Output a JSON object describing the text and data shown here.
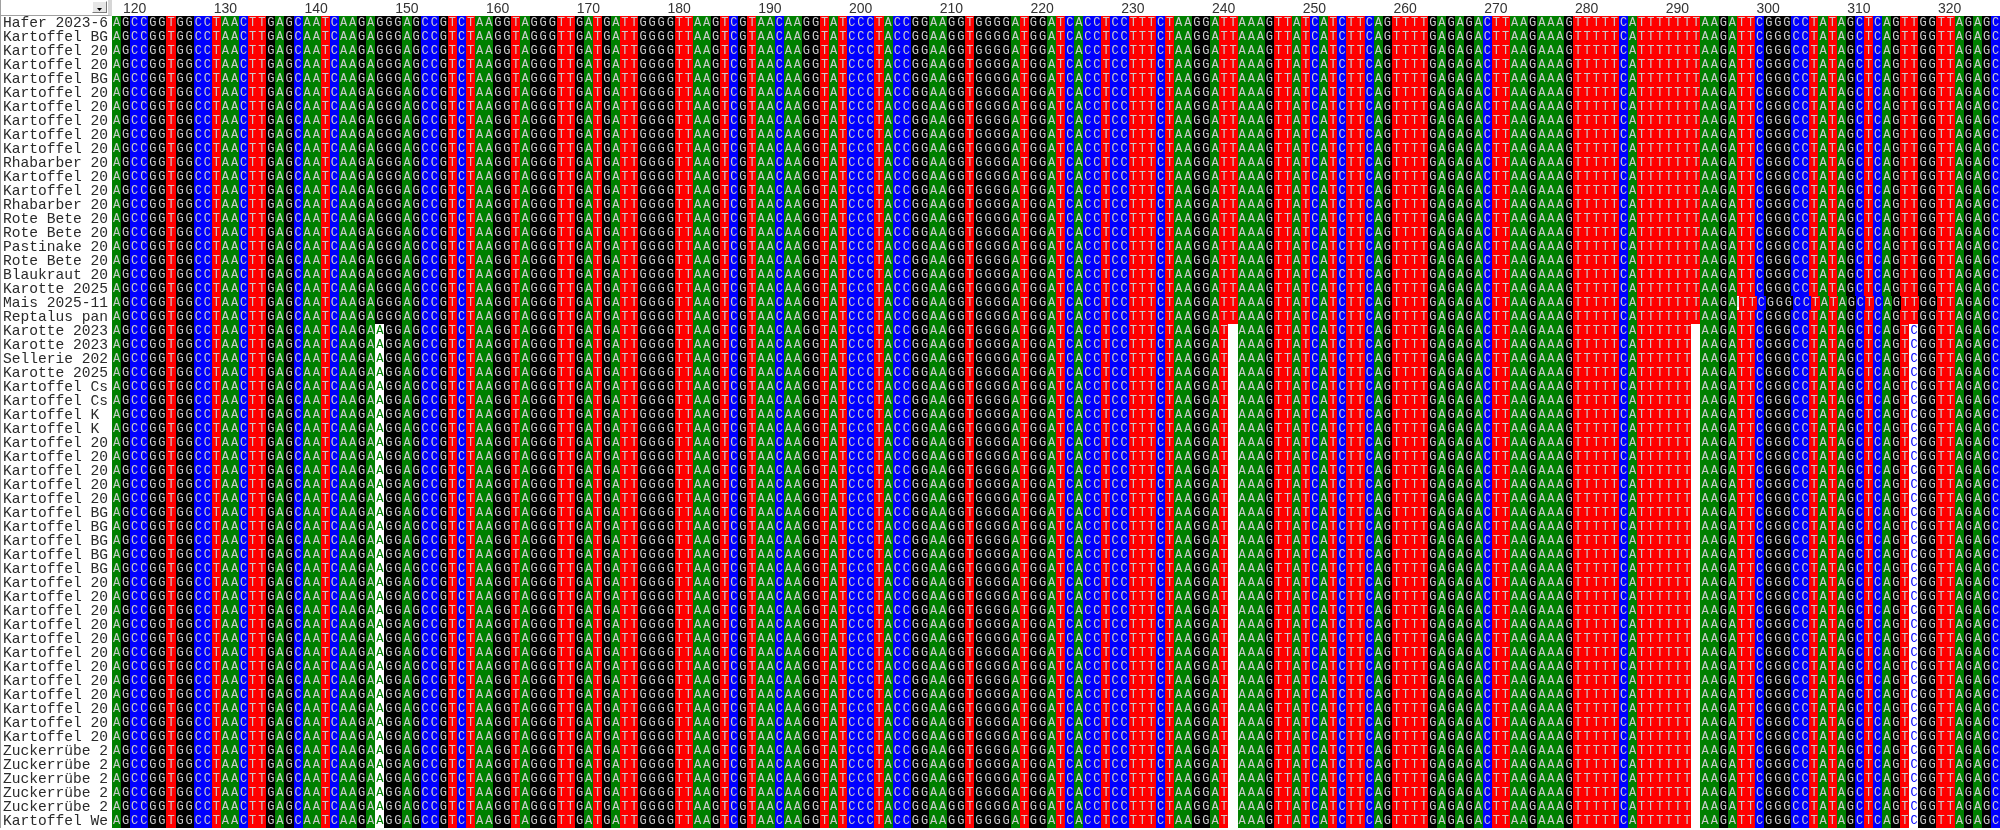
{
  "ruler": {
    "labels": [
      "120",
      "130",
      "140",
      "150",
      "160",
      "170",
      "180",
      "190",
      "200",
      "210",
      "220",
      "230",
      "240",
      "250",
      "260",
      "270",
      "280",
      "290",
      "300",
      "310",
      "320"
    ]
  },
  "sequences": [
    {
      "name": "Hafer 2023-6",
      "segments": [
        {
          "kind": "bases",
          "text": "AGCCGGTGGCCTAACTTGAGCAATCAAGAGGGAGCCGTCTAAGGTAGGGTTGATGATTGGGGTTAAGTCGTAACAAGGTATCCCTACCGGAAGGTGGGGATGGATCACCTCCTTTCTAAGGATTAAAGTTATCATCTTCAGTTTTGAGAGACTTAAGAAAGTTTTTCATTTTTTTAAGATTCGGGCCTATAGCTCAGTTGGTTAGAGC"
        }
      ]
    },
    {
      "name": "Kartoffel BG",
      "segments": [
        {
          "kind": "bases",
          "text": "AGCCGGTGGCCTAACTTGAGCAATCAAGAGGGAGCCGTCTAAGGTAGGGTTGATGATTGGGGTTAAGTCGTAACAAGGTATCCCTACCGGAAGGTGGGGATGGATCACCTCCTTTCTAAGGATTAAAGTTATCATCTTCAGTTTTGAGAGACTTAAGAAAGTTTTTCATTTTTTTAAGATTCGGGCCTATAGCTCAGTTGGTTAGAGC"
        }
      ]
    },
    {
      "name": "Kartoffel 20",
      "segments": [
        {
          "kind": "bases",
          "text": "AGCCGGTGGCCTAACTTGAGCAATCAAGAGGGAGCCGTCTAAGGTAGGGTTGATGATTGGGGTTAAGTCGTAACAAGGTATCCCTACCGGAAGGTGGGGATGGATCACCTCCTTTCTAAGGATTAAAGTTATCATCTTCAGTTTTGAGAGACTTAAGAAAGTTTTTCATTTTTTTAAGATTCGGGCCTATAGCTCAGTTGGTTAGAGC"
        }
      ]
    },
    {
      "name": "Kartoffel 20",
      "segments": [
        {
          "kind": "bases",
          "text": "AGCCGGTGGCCTAACTTGAGCAATCAAGAGGGAGCCGTCTAAGGTAGGGTTGATGATTGGGGTTAAGTCGTAACAAGGTATCCCTACCGGAAGGTGGGGATGGATCACCTCCTTTCTAAGGATTAAAGTTATCATCTTCAGTTTTGAGAGACTTAAGAAAGTTTTTCATTTTTTTAAGATTCGGGCCTATAGCTCAGTTGGTTAGAGC"
        }
      ]
    },
    {
      "name": "Kartoffel BG",
      "segments": [
        {
          "kind": "bases",
          "text": "AGCCGGTGGCCTAACTTGAGCAATCAAGAGGGAGCCGTCTAAGGTAGGGTTGATGATTGGGGTTAAGTCGTAACAAGGTATCCCTACCGGAAGGTGGGGATGGATCACCTCCTTTCTAAGGATTAAAGTTATCATCTTCAGTTTTGAGAGACTTAAGAAAGTTTTTCATTTTTTTAAGATTCGGGCCTATAGCTCAGTTGGTTAGAGC"
        }
      ]
    },
    {
      "name": "Kartoffel 20",
      "segments": [
        {
          "kind": "bases",
          "text": "AGCCGGTGGCCTAACTTGAGCAATCAAGAGGGAGCCGTCTAAGGTAGGGTTGATGATTGGGGTTAAGTCGTAACAAGGTATCCCTACCGGAAGGTGGGGATGGATCACCTCCTTTCTAAGGATTAAAGTTATCATCTTCAGTTTTGAGAGACTTAAGAAAGTTTTTCATTTTTTTAAGATTCGGGCCTATAGCTCAGTTGGTTAGAGC"
        }
      ]
    },
    {
      "name": "Kartoffel 20",
      "segments": [
        {
          "kind": "bases",
          "text": "AGCCGGTGGCCTAACTTGAGCAATCAAGAGGGAGCCGTCTAAGGTAGGGTTGATGATTGGGGTTAAGTCGTAACAAGGTATCCCTACCGGAAGGTGGGGATGGATCACCTCCTTTCTAAGGATTAAAGTTATCATCTTCAGTTTTGAGAGACTTAAGAAAGTTTTTCATTTTTTTAAGATTCGGGCCTATAGCTCAGTTGGTTAGAGC"
        }
      ]
    },
    {
      "name": "Kartoffel 20",
      "segments": [
        {
          "kind": "bases",
          "text": "AGCCGGTGGCCTAACTTGAGCAATCAAGAGGGAGCCGTCTAAGGTAGGGTTGATGATTGGGGTTAAGTCGTAACAAGGTATCCCTACCGGAAGGTGGGGATGGATCACCTCCTTTCTAAGGATTAAAGTTATCATCTTCAGTTTTGAGAGACTTAAGAAAGTTTTTCATTTTTTTAAGATTCGGGCCTATAGCTCAGTTGGTTAGAGC"
        }
      ]
    },
    {
      "name": "Kartoffel 20",
      "segments": [
        {
          "kind": "bases",
          "text": "AGCCGGTGGCCTAACTTGAGCAATCAAGAGGGAGCCGTCTAAGGTAGGGTTGATGATTGGGGTTAAGTCGTAACAAGGTATCCCTACCGGAAGGTGGGGATGGATCACCTCCTTTCTAAGGATTAAAGTTATCATCTTCAGTTTTGAGAGACTTAAGAAAGTTTTTCATTTTTTTAAGATTCGGGCCTATAGCTCAGTTGGTTAGAGC"
        }
      ]
    },
    {
      "name": "Kartoffel 20",
      "segments": [
        {
          "kind": "bases",
          "text": "AGCCGGTGGCCTAACTTGAGCAATCAAGAGGGAGCCGTCTAAGGTAGGGTTGATGATTGGGGTTAAGTCGTAACAAGGTATCCCTACCGGAAGGTGGGGATGGATCACCTCCTTTCTAAGGATTAAAGTTATCATCTTCAGTTTTGAGAGACTTAAGAAAGTTTTTCATTTTTTTAAGATTCGGGCCTATAGCTCAGTTGGTTAGAGC"
        }
      ]
    },
    {
      "name": "Rhabarber 20",
      "segments": [
        {
          "kind": "bases",
          "text": "AGCCGGTGGCCTAACTTGAGCAATCAAGAGGGAGCCGTCTAAGGTAGGGTTGATGATTGGGGTTAAGTCGTAACAAGGTATCCCTACCGGAAGGTGGGGATGGATCACCTCCTTTCTAAGGATTAAAGTTATCATCTTCAGTTTTGAGAGACTTAAGAAAGTTTTTCATTTTTTTAAGATTCGGGCCTATAGCTCAGTTGGTTAGAGC"
        }
      ]
    },
    {
      "name": "Kartoffel 20",
      "segments": [
        {
          "kind": "bases",
          "text": "AGCCGGTGGCCTAACTTGAGCAATCAAGAGGGAGCCGTCTAAGGTAGGGTTGATGATTGGGGTTAAGTCGTAACAAGGTATCCCTACCGGAAGGTGGGGATGGATCACCTCCTTTCTAAGGATTAAAGTTATCATCTTCAGTTTTGAGAGACTTAAGAAAGTTTTTCATTTTTTTAAGATTCGGGCCTATAGCTCAGTTGGTTAGAGC"
        }
      ]
    },
    {
      "name": "Kartoffel 20",
      "segments": [
        {
          "kind": "bases",
          "text": "AGCCGGTGGCCTAACTTGAGCAATCAAGAGGGAGCCGTCTAAGGTAGGGTTGATGATTGGGGTTAAGTCGTAACAAGGTATCCCTACCGGAAGGTGGGGATGGATCACCTCCTTTCTAAGGATTAAAGTTATCATCTTCAGTTTTGAGAGACTTAAGAAAGTTTTTCATTTTTTTAAGATTCGGGCCTATAGCTCAGTTGGTTAGAGC"
        }
      ]
    },
    {
      "name": "Rhabarber 20",
      "segments": [
        {
          "kind": "bases",
          "text": "AGCCGGTGGCCTAACTTGAGCAATCAAGAGGGAGCCGTCTAAGGTAGGGTTGATGATTGGGGTTAAGTCGTAACAAGGTATCCCTACCGGAAGGTGGGGATGGATCACCTCCTTTCTAAGGATTAAAGTTATCATCTTCAGTTTTGAGAGACTTAAGAAAGTTTTTCATTTTTTTAAGATTCGGGCCTATAGCTCAGTTGGTTAGAGC"
        }
      ]
    },
    {
      "name": "Rote Bete 20",
      "segments": [
        {
          "kind": "bases",
          "text": "AGCCGGTGGCCTAACTTGAGCAATCAAGAGGGAGCCGTCTAAGGTAGGGTTGATGATTGGGGTTAAGTCGTAACAAGGTATCCCTACCGGAAGGTGGGGATGGATCACCTCCTTTCTAAGGATTAAAGTTATCATCTTCAGTTTTGAGAGACTTAAGAAAGTTTTTCATTTTTTTAAGATTCGGGCCTATAGCTCAGTTGGTTAGAGC"
        }
      ]
    },
    {
      "name": "Rote Bete 20",
      "segments": [
        {
          "kind": "bases",
          "text": "AGCCGGTGGCCTAACTTGAGCAATCAAGAGGGAGCCGTCTAAGGTAGGGTTGATGATTGGGGTTAAGTCGTAACAAGGTATCCCTACCGGAAGGTGGGGATGGATCACCTCCTTTCTAAGGATTAAAGTTATCATCTTCAGTTTTGAGAGACTTAAGAAAGTTTTTCATTTTTTTAAGATTCGGGCCTATAGCTCAGTTGGTTAGAGC"
        }
      ]
    },
    {
      "name": "Pastinake 20",
      "segments": [
        {
          "kind": "bases",
          "text": "AGCCGGTGGCCTAACTTGAGCAATCAAGAGGGAGCCGTCTAAGGTAGGGTTGATGATTGGGGTTAAGTCGTAACAAGGTATCCCTACCGGAAGGTGGGGATGGATCACCTCCTTTCTAAGGATTAAAGTTATCATCTTCAGTTTTGAGAGACTTAAGAAAGTTTTTCATTTTTTTAAGATTCGGGCCTATAGCTCAGTTGGTTAGAGC"
        }
      ]
    },
    {
      "name": "Rote Bete 20",
      "segments": [
        {
          "kind": "bases",
          "text": "AGCCGGTGGCCTAACTTGAGCAATCAAGAGGGAGCCGTCTAAGGTAGGGTTGATGATTGGGGTTAAGTCGTAACAAGGTATCCCTACCGGAAGGTGGGGATGGATCACCTCCTTTCTAAGGATTAAAGTTATCATCTTCAGTTTTGAGAGACTTAAGAAAGTTTTTCATTTTTTTAAGATTCGGGCCTATAGCTCAGTTGGTTAGAGC"
        }
      ]
    },
    {
      "name": "Blaukraut 20",
      "segments": [
        {
          "kind": "bases",
          "text": "AGCCGGTGGCCTAACTTGAGCAATCAAGAGGGAGCCGTCTAAGGTAGGGTTGATGATTGGGGTTAAGTCGTAACAAGGTATCCCTACCGGAAGGTGGGGATGGATCACCTCCTTTCTAAGGATTAAAGTTATCATCTTCAGTTTTGAGAGACTTAAGAAAGTTTTTCATTTTTTTAAGATTCGGGCCTATAGCTCAGTTGGTTAGAGC"
        }
      ]
    },
    {
      "name": "Karotte 2025",
      "segments": [
        {
          "kind": "bases",
          "text": "AGCCGGTGGCCTAACTTGAGCAATCAAGAGGGAGCCGTCTAAGGTAGGGTTGATGATTGGGGTTAAGTCGTAACAAGGTATCCCTACCGGAAGGTGGGGATGGATCACCTCCTTTCTAAGGATTAAAGTTATCATCTTCAGTTTTGAGAGACTTAAGAAAGTTTTTCATTTTTTTAAGATTCGGGCCTATAGCTCAGTTGGTTAGAGC"
        }
      ]
    },
    {
      "name": "Mais 2025-11",
      "segments": [
        {
          "kind": "bases",
          "text": "AGCCGGTGGCCTAACTTGAGCAATCAAGAGGGAGCCGTCTAAGGTAGGGTTGATGATTGGGGTTAAGTCGTAACAAGGTATCCCTACCGGAAGGTGGGGATGGATCACCTCCTTTCTAAGGATTAAAGTTATCATCTTCAGTTTTGAGAGACTTAAGAAAGTTTTTCATTTTTTTAAGA"
        },
        {
          "kind": "cursor"
        },
        {
          "kind": "bases",
          "text": "TTCGGGCCTATAGCTCAGTTGGTTAGAGC"
        }
      ]
    },
    {
      "name": "Reptalus pan",
      "segments": [
        {
          "kind": "bases",
          "text": "AGCCGGTGGCCTAACTTGAGCAATCAAGAGGGAGCCGTCTAAGGTAGGGTTGATGATTGGGGTTAAGTCGTAACAAGGTATCCCTACCGGAAGGTGGGGATGGATCACCTCCTTTCTAAGGATTAAAGTTATCATCTTCAGTTTTGAGAGACTTAAGAAAGTTTTTCATTTTTTTAAGATTCGGGCCTATAGCTCAGTTGGTTAGAGC"
        }
      ]
    },
    {
      "name": "Karotte 2023",
      "segments": [
        {
          "kind": "bases",
          "text": "AGCCGGTGGCCTAACTTGAGCAATCAAGA"
        },
        {
          "kind": "marked",
          "text": "A"
        },
        {
          "kind": "bases",
          "text": "GGAGCCGTCTAAGGTAGGGTTGATGATTGGGGTTAAGTCGTAACAAGGTATCCCTACCGGAAGGTGGGGATGGATCACCTCCTTTCTAAGGAT"
        },
        {
          "kind": "gap"
        },
        {
          "kind": "bases",
          "text": "AAAGTTATCATCTTCAGTTTTGAGAGACTTAAGAAAGTTTTTCATTTTTT"
        },
        {
          "kind": "gap"
        },
        {
          "kind": "bases",
          "text": "AAGATTCGGGCCTATAGCTCAGT"
        },
        {
          "kind": "marked",
          "text": "C"
        },
        {
          "kind": "bases",
          "text": "GGTTAGAGC"
        }
      ]
    },
    {
      "name": "Karotte 2023",
      "segments": [
        {
          "kind": "bases",
          "text": "AGCCGGTGGCCTAACTTGAGCAATCAAGA"
        },
        {
          "kind": "marked",
          "text": "A"
        },
        {
          "kind": "bases",
          "text": "GGAGCCGTCTAAGGTAGGGTTGATGATTGGGGTTAAGTCGTAACAAGGTATCCCTACCGGAAGGTGGGGATGGATCACCTCCTTTCTAAGGAT"
        },
        {
          "kind": "gap"
        },
        {
          "kind": "bases",
          "text": "AAAGTTATCATCTTCAGTTTTGAGAGACTTAAGAAAGTTTTTCATTTTTT"
        },
        {
          "kind": "gap"
        },
        {
          "kind": "bases",
          "text": "AAGATTCGGGCCTATAGCTCAGT"
        },
        {
          "kind": "marked",
          "text": "C"
        },
        {
          "kind": "bases",
          "text": "GGTTAGAGC"
        }
      ]
    },
    {
      "name": "Sellerie 202",
      "segments": [
        {
          "kind": "bases",
          "text": "AGCCGGTGGCCTAACTTGAGCAATCAAGA"
        },
        {
          "kind": "marked",
          "text": "A"
        },
        {
          "kind": "bases",
          "text": "GGAGCCGTCTAAGGTAGGGTTGATGATTGGGGTTAAGTCGTAACAAGGTATCCCTACCGGAAGGTGGGGATGGATCACCTCCTTTCTAAGGAT"
        },
        {
          "kind": "gap"
        },
        {
          "kind": "bases",
          "text": "AAAGTTATCATCTTCAGTTTTGAGAGACTTAAGAAAGTTTTTCATTTTTT"
        },
        {
          "kind": "gap"
        },
        {
          "kind": "bases",
          "text": "AAGATTCGGGCCTATAGCTCAGT"
        },
        {
          "kind": "marked",
          "text": "C"
        },
        {
          "kind": "bases",
          "text": "GGTTAGAGC"
        }
      ]
    },
    {
      "name": "Karotte 2025",
      "segments": [
        {
          "kind": "bases",
          "text": "AGCCGGTGGCCTAACTTGAGCAATCAAGA"
        },
        {
          "kind": "marked",
          "text": "A"
        },
        {
          "kind": "bases",
          "text": "GGAGCCGTCTAAGGTAGGGTTGATGATTGGGGTTAAGTCGTAACAAGGTATCCCTACCGGAAGGTGGGGATGGATCACCTCCTTTCTAAGGAT"
        },
        {
          "kind": "gap"
        },
        {
          "kind": "bases",
          "text": "AAAGTTATCATCTTCAGTTTTGAGAGACTTAAGAAAGTTTTTCATTTTTT"
        },
        {
          "kind": "gap"
        },
        {
          "kind": "bases",
          "text": "AAGATTCGGGCCTATAGCTCAGT"
        },
        {
          "kind": "marked",
          "text": "C"
        },
        {
          "kind": "bases",
          "text": "GGTTAGAGC"
        }
      ]
    },
    {
      "name": "Kartoffel Cs",
      "segments": [
        {
          "kind": "bases",
          "text": "AGCCGGTGGCCTAACTTGAGCAATCAAGA"
        },
        {
          "kind": "marked",
          "text": "A"
        },
        {
          "kind": "bases",
          "text": "GGAGCCGTCTAAGGTAGGGTTGATGATTGGGGTTAAGTCGTAACAAGGTATCCCTACCGGAAGGTGGGGATGGATCACCTCCTTTCTAAGGAT"
        },
        {
          "kind": "gap"
        },
        {
          "kind": "bases",
          "text": "AAAGTTATCATCTTCAGTTTTGAGAGACTTAAGAAAGTTTTTCATTTTTT"
        },
        {
          "kind": "gap"
        },
        {
          "kind": "bases",
          "text": "AAGATTCGGGCCTATAGCTCAGT"
        },
        {
          "kind": "marked",
          "text": "C"
        },
        {
          "kind": "bases",
          "text": "GGTTAGAGC"
        }
      ]
    },
    {
      "name": "Kartoffel Cs",
      "segments": [
        {
          "kind": "bases",
          "text": "AGCCGGTGGCCTAACTTGAGCAATCAAGA"
        },
        {
          "kind": "marked",
          "text": "A"
        },
        {
          "kind": "bases",
          "text": "GGAGCCGTCTAAGGTAGGGTTGATGATTGGGGTTAAGTCGTAACAAGGTATCCCTACCGGAAGGTGGGGATGGATCACCTCCTTTCTAAGGAT"
        },
        {
          "kind": "gap"
        },
        {
          "kind": "bases",
          "text": "AAAGTTATCATCTTCAGTTTTGAGAGACTTAAGAAAGTTTTTCATTTTTT"
        },
        {
          "kind": "gap"
        },
        {
          "kind": "bases",
          "text": "AAGATTCGGGCCTATAGCTCAGT"
        },
        {
          "kind": "marked",
          "text": "C"
        },
        {
          "kind": "bases",
          "text": "GGTTAGAGC"
        }
      ]
    },
    {
      "name": "Kartoffel K",
      "segments": [
        {
          "kind": "bases",
          "text": "AGCCGGTGGCCTAACTTGAGCAATCAAGA"
        },
        {
          "kind": "marked",
          "text": "A"
        },
        {
          "kind": "bases",
          "text": "GGAGCCGTCTAAGGTAGGGTTGATGATTGGGGTTAAGTCGTAACAAGGTATCCCTACCGGAAGGTGGGGATGGATCACCTCCTTTCTAAGGAT"
        },
        {
          "kind": "gap"
        },
        {
          "kind": "bases",
          "text": "AAAGTTATCATCTTCAGTTTTGAGAGACTTAAGAAAGTTTTTCATTTTTT"
        },
        {
          "kind": "gap"
        },
        {
          "kind": "bases",
          "text": "AAGATTCGGGCCTATAGCTCAGT"
        },
        {
          "kind": "marked",
          "text": "C"
        },
        {
          "kind": "bases",
          "text": "GGTTAGAGC"
        }
      ]
    },
    {
      "name": "Kartoffel K",
      "segments": [
        {
          "kind": "bases",
          "text": "AGCCGGTGGCCTAACTTGAGCAATCAAGA"
        },
        {
          "kind": "marked",
          "text": "A"
        },
        {
          "kind": "bases",
          "text": "GGAGCCGTCTAAGGTAGGGTTGATGATTGGGGTTAAGTCGTAACAAGGTATCCCTACCGGAAGGTGGGGATGGATCACCTCCTTTCTAAGGAT"
        },
        {
          "kind": "gap"
        },
        {
          "kind": "bases",
          "text": "AAAGTTATCATCTTCAGTTTTGAGAGACTTAAGAAAGTTTTTCATTTTTT"
        },
        {
          "kind": "gap"
        },
        {
          "kind": "bases",
          "text": "AAGATTCGGGCCTATAGCTCAGT"
        },
        {
          "kind": "marked",
          "text": "C"
        },
        {
          "kind": "bases",
          "text": "GGTTAGAGC"
        }
      ]
    },
    {
      "name": "Kartoffel 20",
      "segments": [
        {
          "kind": "bases",
          "text": "AGCCGGTGGCCTAACTTGAGCAATCAAGA"
        },
        {
          "kind": "marked",
          "text": "A"
        },
        {
          "kind": "bases",
          "text": "GGAGCCGTCTAAGGTAGGGTTGATGATTGGGGTTAAGTCGTAACAAGGTATCCCTACCGGAAGGTGGGGATGGATCACCTCCTTTCTAAGGAT"
        },
        {
          "kind": "gap"
        },
        {
          "kind": "bases",
          "text": "AAAGTTATCATCTTCAGTTTTGAGAGACTTAAGAAAGTTTTTCATTTTTT"
        },
        {
          "kind": "gap"
        },
        {
          "kind": "bases",
          "text": "AAGATTCGGGCCTATAGCTCAGT"
        },
        {
          "kind": "marked",
          "text": "C"
        },
        {
          "kind": "bases",
          "text": "GGTTAGAGC"
        }
      ]
    },
    {
      "name": "Kartoffel 20",
      "segments": [
        {
          "kind": "bases",
          "text": "AGCCGGTGGCCTAACTTGAGCAATCAAGA"
        },
        {
          "kind": "marked",
          "text": "A"
        },
        {
          "kind": "bases",
          "text": "GGAGCCGTCTAAGGTAGGGTTGATGATTGGGGTTAAGTCGTAACAAGGTATCCCTACCGGAAGGTGGGGATGGATCACCTCCTTTCTAAGGAT"
        },
        {
          "kind": "gap"
        },
        {
          "kind": "bases",
          "text": "AAAGTTATCATCTTCAGTTTTGAGAGACTTAAGAAAGTTTTTCATTTTTT"
        },
        {
          "kind": "gap"
        },
        {
          "kind": "bases",
          "text": "AAGATTCGGGCCTATAGCTCAGT"
        },
        {
          "kind": "marked",
          "text": "C"
        },
        {
          "kind": "bases",
          "text": "GGTTAGAGC"
        }
      ]
    },
    {
      "name": "Kartoffel 20",
      "segments": [
        {
          "kind": "bases",
          "text": "AGCCGGTGGCCTAACTTGAGCAATCAAGA"
        },
        {
          "kind": "marked",
          "text": "A"
        },
        {
          "kind": "bases",
          "text": "GGAGCCGTCTAAGGTAGGGTTGATGATTGGGGTTAAGTCGTAACAAGGTATCCCTACCGGAAGGTGGGGATGGATCACCTCCTTTCTAAGGAT"
        },
        {
          "kind": "gap"
        },
        {
          "kind": "bases",
          "text": "AAAGTTATCATCTTCAGTTTTGAGAGACTTAAGAAAGTTTTTCATTTTTT"
        },
        {
          "kind": "gap"
        },
        {
          "kind": "bases",
          "text": "AAGATTCGGGCCTATAGCTCAGT"
        },
        {
          "kind": "marked",
          "text": "C"
        },
        {
          "kind": "bases",
          "text": "GGTTAGAGC"
        }
      ]
    },
    {
      "name": "Kartoffel 20",
      "segments": [
        {
          "kind": "bases",
          "text": "AGCCGGTGGCCTAACTTGAGCAATCAAGA"
        },
        {
          "kind": "marked",
          "text": "A"
        },
        {
          "kind": "bases",
          "text": "GGAGCCGTCTAAGGTAGGGTTGATGATTGGGGTTAAGTCGTAACAAGGTATCCCTACCGGAAGGTGGGGATGGATCACCTCCTTTCTAAGGAT"
        },
        {
          "kind": "gap"
        },
        {
          "kind": "bases",
          "text": "AAAGTTATCATCTTCAGTTTTGAGAGACTTAAGAAAGTTTTTCATTTTTT"
        },
        {
          "kind": "gap"
        },
        {
          "kind": "bases",
          "text": "AAGATTCGGGCCTATAGCTCAGT"
        },
        {
          "kind": "marked",
          "text": "C"
        },
        {
          "kind": "bases",
          "text": "GGTTAGAGC"
        }
      ]
    },
    {
      "name": "Kartoffel 20",
      "segments": [
        {
          "kind": "bases",
          "text": "AGCCGGTGGCCTAACTTGAGCAATCAAGA"
        },
        {
          "kind": "marked",
          "text": "A"
        },
        {
          "kind": "bases",
          "text": "GGAGCCGTCTAAGGTAGGGTTGATGATTGGGGTTAAGTCGTAACAAGGTATCCCTACCGGAAGGTGGGGATGGATCACCTCCTTTCTAAGGAT"
        },
        {
          "kind": "gap"
        },
        {
          "kind": "bases",
          "text": "AAAGTTATCATCTTCAGTTTTGAGAGACTTAAGAAAGTTTTTCATTTTTT"
        },
        {
          "kind": "gap"
        },
        {
          "kind": "bases",
          "text": "AAGATTCGGGCCTATAGCTCAGT"
        },
        {
          "kind": "marked",
          "text": "C"
        },
        {
          "kind": "bases",
          "text": "GGTTAGAGC"
        }
      ]
    },
    {
      "name": "Kartoffel BG",
      "segments": [
        {
          "kind": "bases",
          "text": "AGCCGGTGGCCTAACTTGAGCAATCAAGA"
        },
        {
          "kind": "marked",
          "text": "A"
        },
        {
          "kind": "bases",
          "text": "GGAGCCGTCTAAGGTAGGGTTGATGATTGGGGTTAAGTCGTAACAAGGTATCCCTACCGGAAGGTGGGGATGGATCACCTCCTTTCTAAGGAT"
        },
        {
          "kind": "gap"
        },
        {
          "kind": "bases",
          "text": "AAAGTTATCATCTTCAGTTTTGAGAGACTTAAGAAAGTTTTTCATTTTTT"
        },
        {
          "kind": "gap"
        },
        {
          "kind": "bases",
          "text": "AAGATTCGGGCCTATAGCTCAGT"
        },
        {
          "kind": "marked",
          "text": "C"
        },
        {
          "kind": "bases",
          "text": "GGTTAGAGC"
        }
      ]
    },
    {
      "name": "Kartoffel BG",
      "segments": [
        {
          "kind": "bases",
          "text": "AGCCGGTGGCCTAACTTGAGCAATCAAGA"
        },
        {
          "kind": "marked",
          "text": "A"
        },
        {
          "kind": "bases",
          "text": "GGAGCCGTCTAAGGTAGGGTTGATGATTGGGGTTAAGTCGTAACAAGGTATCCCTACCGGAAGGTGGGGATGGATCACCTCCTTTCTAAGGAT"
        },
        {
          "kind": "gap"
        },
        {
          "kind": "bases",
          "text": "AAAGTTATCATCTTCAGTTTTGAGAGACTTAAGAAAGTTTTTCATTTTTT"
        },
        {
          "kind": "gap"
        },
        {
          "kind": "bases",
          "text": "AAGATTCGGGCCTATAGCTCAGT"
        },
        {
          "kind": "marked",
          "text": "C"
        },
        {
          "kind": "bases",
          "text": "GGTTAGAGC"
        }
      ]
    },
    {
      "name": "Kartoffel BG",
      "segments": [
        {
          "kind": "bases",
          "text": "AGCCGGTGGCCTAACTTGAGCAATCAAGA"
        },
        {
          "kind": "marked",
          "text": "A"
        },
        {
          "kind": "bases",
          "text": "GGAGCCGTCTAAGGTAGGGTTGATGATTGGGGTTAAGTCGTAACAAGGTATCCCTACCGGAAGGTGGGGATGGATCACCTCCTTTCTAAGGAT"
        },
        {
          "kind": "gap"
        },
        {
          "kind": "bases",
          "text": "AAAGTTATCATCTTCAGTTTTGAGAGACTTAAGAAAGTTTTTCATTTTTT"
        },
        {
          "kind": "gap"
        },
        {
          "kind": "bases",
          "text": "AAGATTCGGGCCTATAGCTCAGT"
        },
        {
          "kind": "marked",
          "text": "C"
        },
        {
          "kind": "bases",
          "text": "GGTTAGAGC"
        }
      ]
    },
    {
      "name": "Kartoffel BG",
      "segments": [
        {
          "kind": "bases",
          "text": "AGCCGGTGGCCTAACTTGAGCAATCAAGA"
        },
        {
          "kind": "marked",
          "text": "A"
        },
        {
          "kind": "bases",
          "text": "GGAGCCGTCTAAGGTAGGGTTGATGATTGGGGTTAAGTCGTAACAAGGTATCCCTACCGGAAGGTGGGGATGGATCACCTCCTTTCTAAGGAT"
        },
        {
          "kind": "gap"
        },
        {
          "kind": "bases",
          "text": "AAAGTTATCATCTTCAGTTTTGAGAGACTTAAGAAAGTTTTTCATTTTTT"
        },
        {
          "kind": "gap"
        },
        {
          "kind": "bases",
          "text": "AAGATTCGGGCCTATAGCTCAGT"
        },
        {
          "kind": "marked",
          "text": "C"
        },
        {
          "kind": "bases",
          "text": "GGTTAGAGC"
        }
      ]
    },
    {
      "name": "Kartoffel BG",
      "segments": [
        {
          "kind": "bases",
          "text": "AGCCGGTGGCCTAACTTGAGCAATCAAGA"
        },
        {
          "kind": "marked",
          "text": "A"
        },
        {
          "kind": "bases",
          "text": "GGAGCCGTCTAAGGTAGGGTTGATGATTGGGGTTAAGTCGTAACAAGGTATCCCTACCGGAAGGTGGGGATGGATCACCTCCTTTCTAAGGAT"
        },
        {
          "kind": "gap"
        },
        {
          "kind": "bases",
          "text": "AAAGTTATCATCTTCAGTTTTGAGAGACTTAAGAAAGTTTTTCATTTTTT"
        },
        {
          "kind": "gap"
        },
        {
          "kind": "bases",
          "text": "AAGATTCGGGCCTATAGCTCAGT"
        },
        {
          "kind": "marked",
          "text": "C"
        },
        {
          "kind": "bases",
          "text": "GGTTAGAGC"
        }
      ]
    },
    {
      "name": "Kartoffel 20",
      "segments": [
        {
          "kind": "bases",
          "text": "AGCCGGTGGCCTAACTTGAGCAATCAAGA"
        },
        {
          "kind": "marked",
          "text": "A"
        },
        {
          "kind": "bases",
          "text": "GGAGCCGTCTAAGGTAGGGTTGATGATTGGGGTTAAGTCGTAACAAGGTATCCCTACCGGAAGGTGGGGATGGATCACCTCCTTTCTAAGGAT"
        },
        {
          "kind": "gap"
        },
        {
          "kind": "bases",
          "text": "AAAGTTATCATCTTCAGTTTTGAGAGACTTAAGAAAGTTTTTCATTTTTT"
        },
        {
          "kind": "gap"
        },
        {
          "kind": "bases",
          "text": "AAGATTCGGGCCTATAGCTCAGT"
        },
        {
          "kind": "marked",
          "text": "C"
        },
        {
          "kind": "bases",
          "text": "GGTTAGAGC"
        }
      ]
    },
    {
      "name": "Kartoffel 20",
      "segments": [
        {
          "kind": "bases",
          "text": "AGCCGGTGGCCTAACTTGAGCAATCAAGA"
        },
        {
          "kind": "marked",
          "text": "A"
        },
        {
          "kind": "bases",
          "text": "GGAGCCGTCTAAGGTAGGGTTGATGATTGGGGTTAAGTCGTAACAAGGTATCCCTACCGGAAGGTGGGGATGGATCACCTCCTTTCTAAGGAT"
        },
        {
          "kind": "gap"
        },
        {
          "kind": "bases",
          "text": "AAAGTTATCATCTTCAGTTTTGAGAGACTTAAGAAAGTTTTTCATTTTTT"
        },
        {
          "kind": "gap"
        },
        {
          "kind": "bases",
          "text": "AAGATTCGGGCCTATAGCTCAGT"
        },
        {
          "kind": "marked",
          "text": "C"
        },
        {
          "kind": "bases",
          "text": "GGTTAGAGC"
        }
      ]
    },
    {
      "name": "Kartoffel 20",
      "segments": [
        {
          "kind": "bases",
          "text": "AGCCGGTGGCCTAACTTGAGCAATCAAGA"
        },
        {
          "kind": "marked",
          "text": "A"
        },
        {
          "kind": "bases",
          "text": "GGAGCCGTCTAAGGTAGGGTTGATGATTGGGGTTAAGTCGTAACAAGGTATCCCTACCGGAAGGTGGGGATGGATCACCTCCTTTCTAAGGAT"
        },
        {
          "kind": "gap"
        },
        {
          "kind": "bases",
          "text": "AAAGTTATCATCTTCAGTTTTGAGAGACTTAAGAAAGTTTTTCATTTTTT"
        },
        {
          "kind": "gap"
        },
        {
          "kind": "bases",
          "text": "AAGATTCGGGCCTATAGCTCAGT"
        },
        {
          "kind": "marked",
          "text": "C"
        },
        {
          "kind": "bases",
          "text": "GGTTAGAGC"
        }
      ]
    },
    {
      "name": "Kartoffel 20",
      "segments": [
        {
          "kind": "bases",
          "text": "AGCCGGTGGCCTAACTTGAGCAATCAAGA"
        },
        {
          "kind": "marked",
          "text": "A"
        },
        {
          "kind": "bases",
          "text": "GGAGCCGTCTAAGGTAGGGTTGATGATTGGGGTTAAGTCGTAACAAGGTATCCCTACCGGAAGGTGGGGATGGATCACCTCCTTTCTAAGGAT"
        },
        {
          "kind": "gap"
        },
        {
          "kind": "bases",
          "text": "AAAGTTATCATCTTCAGTTTTGAGAGACTTAAGAAAGTTTTTCATTTTTT"
        },
        {
          "kind": "gap"
        },
        {
          "kind": "bases",
          "text": "AAGATTCGGGCCTATAGCTCAGT"
        },
        {
          "kind": "marked",
          "text": "C"
        },
        {
          "kind": "bases",
          "text": "GGTTAGAGC"
        }
      ]
    },
    {
      "name": "Kartoffel 20",
      "segments": [
        {
          "kind": "bases",
          "text": "AGCCGGTGGCCTAACTTGAGCAATCAAGA"
        },
        {
          "kind": "marked",
          "text": "A"
        },
        {
          "kind": "bases",
          "text": "GGAGCCGTCTAAGGTAGGGTTGATGATTGGGGTTAAGTCGTAACAAGGTATCCCTACCGGAAGGTGGGGATGGATCACCTCCTTTCTAAGGAT"
        },
        {
          "kind": "gap"
        },
        {
          "kind": "bases",
          "text": "AAAGTTATCATCTTCAGTTTTGAGAGACTTAAGAAAGTTTTTCATTTTTT"
        },
        {
          "kind": "gap"
        },
        {
          "kind": "bases",
          "text": "AAGATTCGGGCCTATAGCTCAGT"
        },
        {
          "kind": "marked",
          "text": "C"
        },
        {
          "kind": "bases",
          "text": "GGTTAGAGC"
        }
      ]
    },
    {
      "name": "Kartoffel 20",
      "segments": [
        {
          "kind": "bases",
          "text": "AGCCGGTGGCCTAACTTGAGCAATCAAGA"
        },
        {
          "kind": "marked",
          "text": "A"
        },
        {
          "kind": "bases",
          "text": "GGAGCCGTCTAAGGTAGGGTTGATGATTGGGGTTAAGTCGTAACAAGGTATCCCTACCGGAAGGTGGGGATGGATCACCTCCTTTCTAAGGAT"
        },
        {
          "kind": "gap"
        },
        {
          "kind": "bases",
          "text": "AAAGTTATCATCTTCAGTTTTGAGAGACTTAAGAAAGTTTTTCATTTTTT"
        },
        {
          "kind": "gap"
        },
        {
          "kind": "bases",
          "text": "AAGATTCGGGCCTATAGCTCAGT"
        },
        {
          "kind": "marked",
          "text": "C"
        },
        {
          "kind": "bases",
          "text": "GGTTAGAGC"
        }
      ]
    },
    {
      "name": "Kartoffel 20",
      "segments": [
        {
          "kind": "bases",
          "text": "AGCCGGTGGCCTAACTTGAGCAATCAAGA"
        },
        {
          "kind": "marked",
          "text": "A"
        },
        {
          "kind": "bases",
          "text": "GGAGCCGTCTAAGGTAGGGTTGATGATTGGGGTTAAGTCGTAACAAGGTATCCCTACCGGAAGGTGGGGATGGATCACCTCCTTTCTAAGGAT"
        },
        {
          "kind": "gap"
        },
        {
          "kind": "bases",
          "text": "AAAGTTATCATCTTCAGTTTTGAGAGACTTAAGAAAGTTTTTCATTTTTT"
        },
        {
          "kind": "gap"
        },
        {
          "kind": "bases",
          "text": "AAGATTCGGGCCTATAGCTCAGT"
        },
        {
          "kind": "marked",
          "text": "C"
        },
        {
          "kind": "bases",
          "text": "GGTTAGAGC"
        }
      ]
    },
    {
      "name": "Kartoffel 20",
      "segments": [
        {
          "kind": "bases",
          "text": "AGCCGGTGGCCTAACTTGAGCAATCAAGA"
        },
        {
          "kind": "marked",
          "text": "A"
        },
        {
          "kind": "bases",
          "text": "GGAGCCGTCTAAGGTAGGGTTGATGATTGGGGTTAAGTCGTAACAAGGTATCCCTACCGGAAGGTGGGGATGGATCACCTCCTTTCTAAGGAT"
        },
        {
          "kind": "gap"
        },
        {
          "kind": "bases",
          "text": "AAAGTTATCATCTTCAGTTTTGAGAGACTTAAGAAAGTTTTTCATTTTTT"
        },
        {
          "kind": "gap"
        },
        {
          "kind": "bases",
          "text": "AAGATTCGGGCCTATAGCTCAGT"
        },
        {
          "kind": "marked",
          "text": "C"
        },
        {
          "kind": "bases",
          "text": "GGTTAGAGC"
        }
      ]
    },
    {
      "name": "Kartoffel 20",
      "segments": [
        {
          "kind": "bases",
          "text": "AGCCGGTGGCCTAACTTGAGCAATCAAGA"
        },
        {
          "kind": "marked",
          "text": "A"
        },
        {
          "kind": "bases",
          "text": "GGAGCCGTCTAAGGTAGGGTTGATGATTGGGGTTAAGTCGTAACAAGGTATCCCTACCGGAAGGTGGGGATGGATCACCTCCTTTCTAAGGAT"
        },
        {
          "kind": "gap"
        },
        {
          "kind": "bases",
          "text": "AAAGTTATCATCTTCAGTTTTGAGAGACTTAAGAAAGTTTTTCATTTTTT"
        },
        {
          "kind": "gap"
        },
        {
          "kind": "bases",
          "text": "AAGATTCGGGCCTATAGCTCAGT"
        },
        {
          "kind": "marked",
          "text": "C"
        },
        {
          "kind": "bases",
          "text": "GGTTAGAGC"
        }
      ]
    },
    {
      "name": "Kartoffel 20",
      "segments": [
        {
          "kind": "bases",
          "text": "AGCCGGTGGCCTAACTTGAGCAATCAAGA"
        },
        {
          "kind": "marked",
          "text": "A"
        },
        {
          "kind": "bases",
          "text": "GGAGCCGTCTAAGGTAGGGTTGATGATTGGGGTTAAGTCGTAACAAGGTATCCCTACCGGAAGGTGGGGATGGATCACCTCCTTTCTAAGGAT"
        },
        {
          "kind": "gap"
        },
        {
          "kind": "bases",
          "text": "AAAGTTATCATCTTCAGTTTTGAGAGACTTAAGAAAGTTTTTCATTTTTT"
        },
        {
          "kind": "gap"
        },
        {
          "kind": "bases",
          "text": "AAGATTCGGGCCTATAGCTCAGT"
        },
        {
          "kind": "marked",
          "text": "C"
        },
        {
          "kind": "bases",
          "text": "GGTTAGAGC"
        }
      ]
    },
    {
      "name": "Kartoffel 20",
      "segments": [
        {
          "kind": "bases",
          "text": "AGCCGGTGGCCTAACTTGAGCAATCAAGA"
        },
        {
          "kind": "marked",
          "text": "A"
        },
        {
          "kind": "bases",
          "text": "GGAGCCGTCTAAGGTAGGGTTGATGATTGGGGTTAAGTCGTAACAAGGTATCCCTACCGGAAGGTGGGGATGGATCACCTCCTTTCTAAGGAT"
        },
        {
          "kind": "gap"
        },
        {
          "kind": "bases",
          "text": "AAAGTTATCATCTTCAGTTTTGAGAGACTTAAGAAAGTTTTTCATTTTTT"
        },
        {
          "kind": "gap"
        },
        {
          "kind": "bases",
          "text": "AAGATTCGGGCCTATAGCTCAGT"
        },
        {
          "kind": "marked",
          "text": "C"
        },
        {
          "kind": "bases",
          "text": "GGTTAGAGC"
        }
      ]
    },
    {
      "name": "Kartoffel 20",
      "segments": [
        {
          "kind": "bases",
          "text": "AGCCGGTGGCCTAACTTGAGCAATCAAGA"
        },
        {
          "kind": "marked",
          "text": "A"
        },
        {
          "kind": "bases",
          "text": "GGAGCCGTCTAAGGTAGGGTTGATGATTGGGGTTAAGTCGTAACAAGGTATCCCTACCGGAAGGTGGGGATGGATCACCTCCTTTCTAAGGAT"
        },
        {
          "kind": "gap"
        },
        {
          "kind": "bases",
          "text": "AAAGTTATCATCTTCAGTTTTGAGAGACTTAAGAAAGTTTTTCATTTTTT"
        },
        {
          "kind": "gap"
        },
        {
          "kind": "bases",
          "text": "AAGATTCGGGCCTATAGCTCAGT"
        },
        {
          "kind": "marked",
          "text": "C"
        },
        {
          "kind": "bases",
          "text": "GGTTAGAGC"
        }
      ]
    },
    {
      "name": "Zuckerrübe 2",
      "segments": [
        {
          "kind": "bases",
          "text": "AGCCGGTGGCCTAACTTGAGCAATCAAGA"
        },
        {
          "kind": "marked",
          "text": "A"
        },
        {
          "kind": "bases",
          "text": "GGAGCCGTCTAAGGTAGGGTTGATGATTGGGGTTAAGTCGTAACAAGGTATCCCTACCGGAAGGTGGGGATGGATCACCTCCTTTCTAAGGAT"
        },
        {
          "kind": "gap"
        },
        {
          "kind": "bases",
          "text": "AAAGTTATCATCTTCAGTTTTGAGAGACTTAAGAAAGTTTTTCATTTTTT"
        },
        {
          "kind": "gap"
        },
        {
          "kind": "bases",
          "text": "AAGATTCGGGCCTATAGCTCAGT"
        },
        {
          "kind": "marked",
          "text": "C"
        },
        {
          "kind": "bases",
          "text": "GGTTAGAGC"
        }
      ]
    },
    {
      "name": "Zuckerrübe 2",
      "segments": [
        {
          "kind": "bases",
          "text": "AGCCGGTGGCCTAACTTGAGCAATCAAGA"
        },
        {
          "kind": "marked",
          "text": "A"
        },
        {
          "kind": "bases",
          "text": "GGAGCCGTCTAAGGTAGGGTTGATGATTGGGGTTAAGTCGTAACAAGGTATCCCTACCGGAAGGTGGGGATGGATCACCTCCTTTCTAAGGAT"
        },
        {
          "kind": "gap"
        },
        {
          "kind": "bases",
          "text": "AAAGTTATCATCTTCAGTTTTGAGAGACTTAAGAAAGTTTTTCATTTTTT"
        },
        {
          "kind": "gap"
        },
        {
          "kind": "bases",
          "text": "AAGATTCGGGCCTATAGCTCAGT"
        },
        {
          "kind": "marked",
          "text": "C"
        },
        {
          "kind": "bases",
          "text": "GGTTAGAGC"
        }
      ]
    },
    {
      "name": "Zuckerrübe 2",
      "segments": [
        {
          "kind": "bases",
          "text": "AGCCGGTGGCCTAACTTGAGCAATCAAGA"
        },
        {
          "kind": "marked",
          "text": "A"
        },
        {
          "kind": "bases",
          "text": "GGAGCCGTCTAAGGTAGGGTTGATGATTGGGGTTAAGTCGTAACAAGGTATCCCTACCGGAAGGTGGGGATGGATCACCTCCTTTCTAAGGAT"
        },
        {
          "kind": "gap"
        },
        {
          "kind": "bases",
          "text": "AAAGTTATCATCTTCAGTTTTGAGAGACTTAAGAAAGTTTTTCATTTTTT"
        },
        {
          "kind": "gap"
        },
        {
          "kind": "bases",
          "text": "AAGATTCGGGCCTATAGCTCAGT"
        },
        {
          "kind": "marked",
          "text": "C"
        },
        {
          "kind": "bases",
          "text": "GGTTAGAGC"
        }
      ]
    },
    {
      "name": "Zuckerrübe 2",
      "segments": [
        {
          "kind": "bases",
          "text": "AGCCGGTGGCCTAACTTGAGCAATCAAGA"
        },
        {
          "kind": "marked",
          "text": "A"
        },
        {
          "kind": "bases",
          "text": "GGAGCCGTCTAAGGTAGGGTTGATGATTGGGGTTAAGTCGTAACAAGGTATCCCTACCGGAAGGTGGGGATGGATCACCTCCTTTCTAAGGAT"
        },
        {
          "kind": "gap"
        },
        {
          "kind": "bases",
          "text": "AAAGTTATCATCTTCAGTTTTGAGAGACTTAAGAAAGTTTTTCATTTTTT"
        },
        {
          "kind": "gap"
        },
        {
          "kind": "bases",
          "text": "AAGATTCGGGCCTATAGCTCAGT"
        },
        {
          "kind": "marked",
          "text": "C"
        },
        {
          "kind": "bases",
          "text": "GGTTAGAGC"
        }
      ]
    },
    {
      "name": "Zuckerrübe 2",
      "segments": [
        {
          "kind": "bases",
          "text": "AGCCGGTGGCCTAACTTGAGCAATCAAGA"
        },
        {
          "kind": "marked",
          "text": "A"
        },
        {
          "kind": "bases",
          "text": "GGAGCCGTCTAAGGTAGGGTTGATGATTGGGGTTAAGTCGTAACAAGGTATCCCTACCGGAAGGTGGGGATGGATCACCTCCTTTCTAAGGAT"
        },
        {
          "kind": "gap"
        },
        {
          "kind": "bases",
          "text": "AAAGTTATCATCTTCAGTTTTGAGAGACTTAAGAAAGTTTTTCATTTTTT"
        },
        {
          "kind": "gap"
        },
        {
          "kind": "bases",
          "text": "AAGATTCGGGCCTATAGCTCAGT"
        },
        {
          "kind": "marked",
          "text": "C"
        },
        {
          "kind": "bases",
          "text": "GGTTAGAGC"
        }
      ]
    },
    {
      "name": "Kartoffel We",
      "segments": [
        {
          "kind": "bases",
          "text": "AGCCGGTGGCCTAACTTGAGCAATCAAGA"
        },
        {
          "kind": "marked",
          "text": "A"
        },
        {
          "kind": "bases",
          "text": "GGAGCCGTCTAAGGTAGGGTTGATGATTGGGGTTAAGTCGTAACAAGGTATCCCTACCGGAAGGTGGGGATGGATCACCTCCTTTCTAAGGAT"
        },
        {
          "kind": "gap"
        },
        {
          "kind": "bases",
          "text": "AAAGTTATCATCTTCAGTTTTGAGAGACTTAAGAAAGTTTTTCATTTTTT"
        },
        {
          "kind": "gap"
        },
        {
          "kind": "bases",
          "text": "AAGATTCGGGCCTATAGCTCAGT"
        },
        {
          "kind": "marked",
          "text": "C"
        },
        {
          "kind": "bases",
          "text": "GGTTAGAGC"
        }
      ]
    }
  ]
}
